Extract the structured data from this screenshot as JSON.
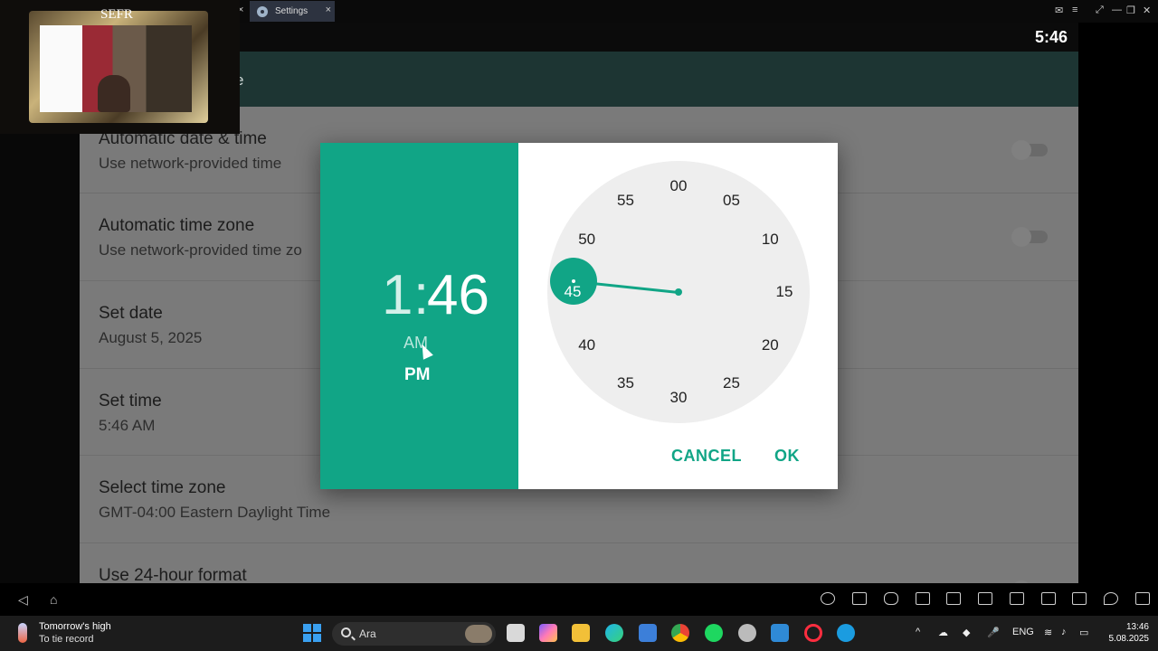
{
  "emulator": {
    "tab_settings_label": "Settings",
    "close_glyph": "×"
  },
  "status_bar": {
    "clock": "5:46"
  },
  "app_bar": {
    "title_fragment": "e"
  },
  "webcam": {
    "label": "SEFR"
  },
  "settings": {
    "rows": [
      {
        "title": "Automatic date & time",
        "subtitle": "Use network-provided time",
        "toggle": "off"
      },
      {
        "title": "Automatic time zone",
        "subtitle": "Use network-provided time zo",
        "toggle": "off"
      },
      {
        "title": "Set date",
        "subtitle": "August 5, 2025"
      },
      {
        "title": "Set time",
        "subtitle": "5:46 AM"
      },
      {
        "title": "Select time zone",
        "subtitle": "GMT-04:00 Eastern Daylight Time"
      },
      {
        "title": "Use 24-hour format",
        "subtitle": "",
        "toggle": "off"
      }
    ]
  },
  "time_picker": {
    "hour": "1",
    "separator": ":",
    "minute": "46",
    "am_label": "AM",
    "pm_label": "PM",
    "selected_period": "PM",
    "minute_labels": [
      "00",
      "05",
      "10",
      "15",
      "20",
      "25",
      "30",
      "35",
      "40",
      "45",
      "50",
      "55"
    ],
    "selected_minute": 46,
    "cancel_label": "CANCEL",
    "ok_label": "OK",
    "accent_color": "#11a586"
  },
  "taskbar": {
    "weather_title": "Tomorrow's high",
    "weather_sub": "To tie record",
    "search_placeholder": "Ara",
    "language": "ENG",
    "time": "13:46",
    "date": "5.08.2025"
  }
}
